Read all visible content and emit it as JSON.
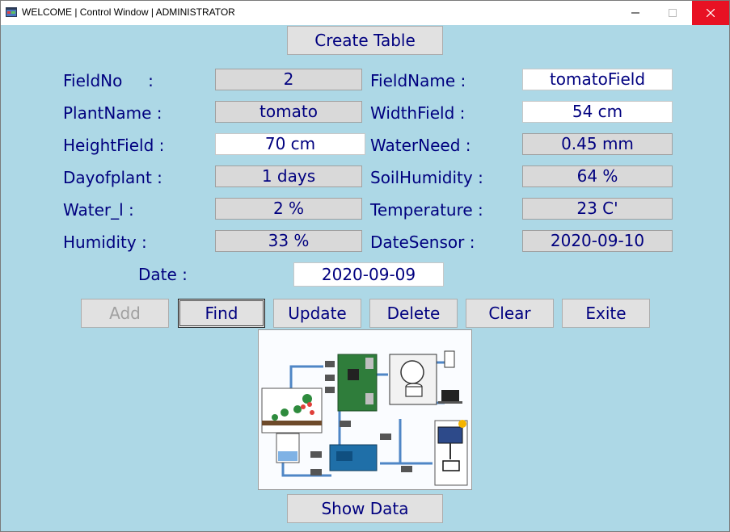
{
  "window": {
    "title": "WELCOME | Control Window | ADMINISTRATOR"
  },
  "buttons": {
    "create_table": "Create Table",
    "add": "Add",
    "find": "Find",
    "update": "Update",
    "delete": "Delete",
    "clear": "Clear",
    "exit": "Exite",
    "show_data": "Show Data"
  },
  "form": {
    "field_no": {
      "label": "FieldNo     :",
      "value": "2"
    },
    "field_name": {
      "label": "FieldName :",
      "value": "tomatoField"
    },
    "plant_name": {
      "label": "PlantName :",
      "value": "tomato"
    },
    "width_field": {
      "label": "WidthField :",
      "value": "54 cm"
    },
    "height_field": {
      "label": "HeightField :",
      "value": "70 cm"
    },
    "water_need": {
      "label": "WaterNeed :",
      "value": "0.45 mm"
    },
    "day_of_plant": {
      "label": "Dayofplant :",
      "value": "1 days"
    },
    "soil_humidity": {
      "label": "SoilHumidity :",
      "value": "64 %"
    },
    "water_l": {
      "label": "Water_l :",
      "value": "2 %"
    },
    "temperature": {
      "label": "Temperature :",
      "value": "23 C'"
    },
    "humidity": {
      "label": "Humidity :",
      "value": "33 %"
    },
    "date_sensor": {
      "label": "DateSensor :",
      "value": "2020-09-10"
    },
    "date": {
      "label": "Date :",
      "value": "2020-09-09"
    }
  },
  "colors": {
    "background": "#add8e6",
    "text": "#00007f",
    "readonly_field": "#d9d9d9",
    "close_button": "#e81123"
  },
  "icons": {
    "app": "app-window-icon",
    "minimize": "minimize-icon",
    "maximize": "maximize-icon",
    "close": "close-icon"
  }
}
